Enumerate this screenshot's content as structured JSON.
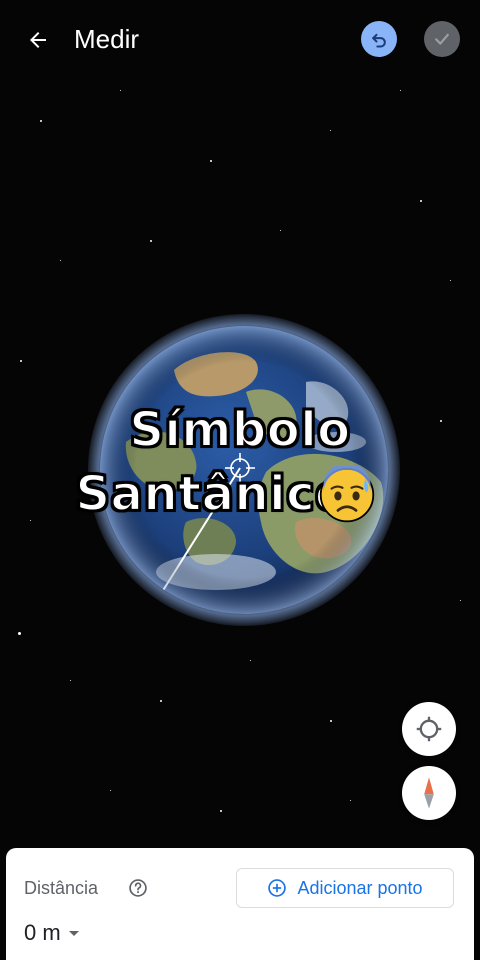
{
  "topbar": {
    "title": "Medir",
    "back_icon": "arrow-back-icon",
    "undo_icon": "undo-icon",
    "done_icon": "check-icon",
    "undo_color": "#8ab4f8",
    "done_color": "#5f6368"
  },
  "overlay": {
    "line1": "Símbolo",
    "line2": "Santânico",
    "emoji": "anxious-face-with-sweat-icon"
  },
  "map_controls": {
    "locate_icon": "my-location-icon",
    "compass_icon": "compass-icon"
  },
  "bottom_sheet": {
    "distance_label": "Distância",
    "help_icon": "help-circle-icon",
    "add_point_label": "Adicionar ponto",
    "add_point_icon": "add-circle-icon",
    "distance_value": "0 m",
    "accent_color": "#1a73e8"
  }
}
